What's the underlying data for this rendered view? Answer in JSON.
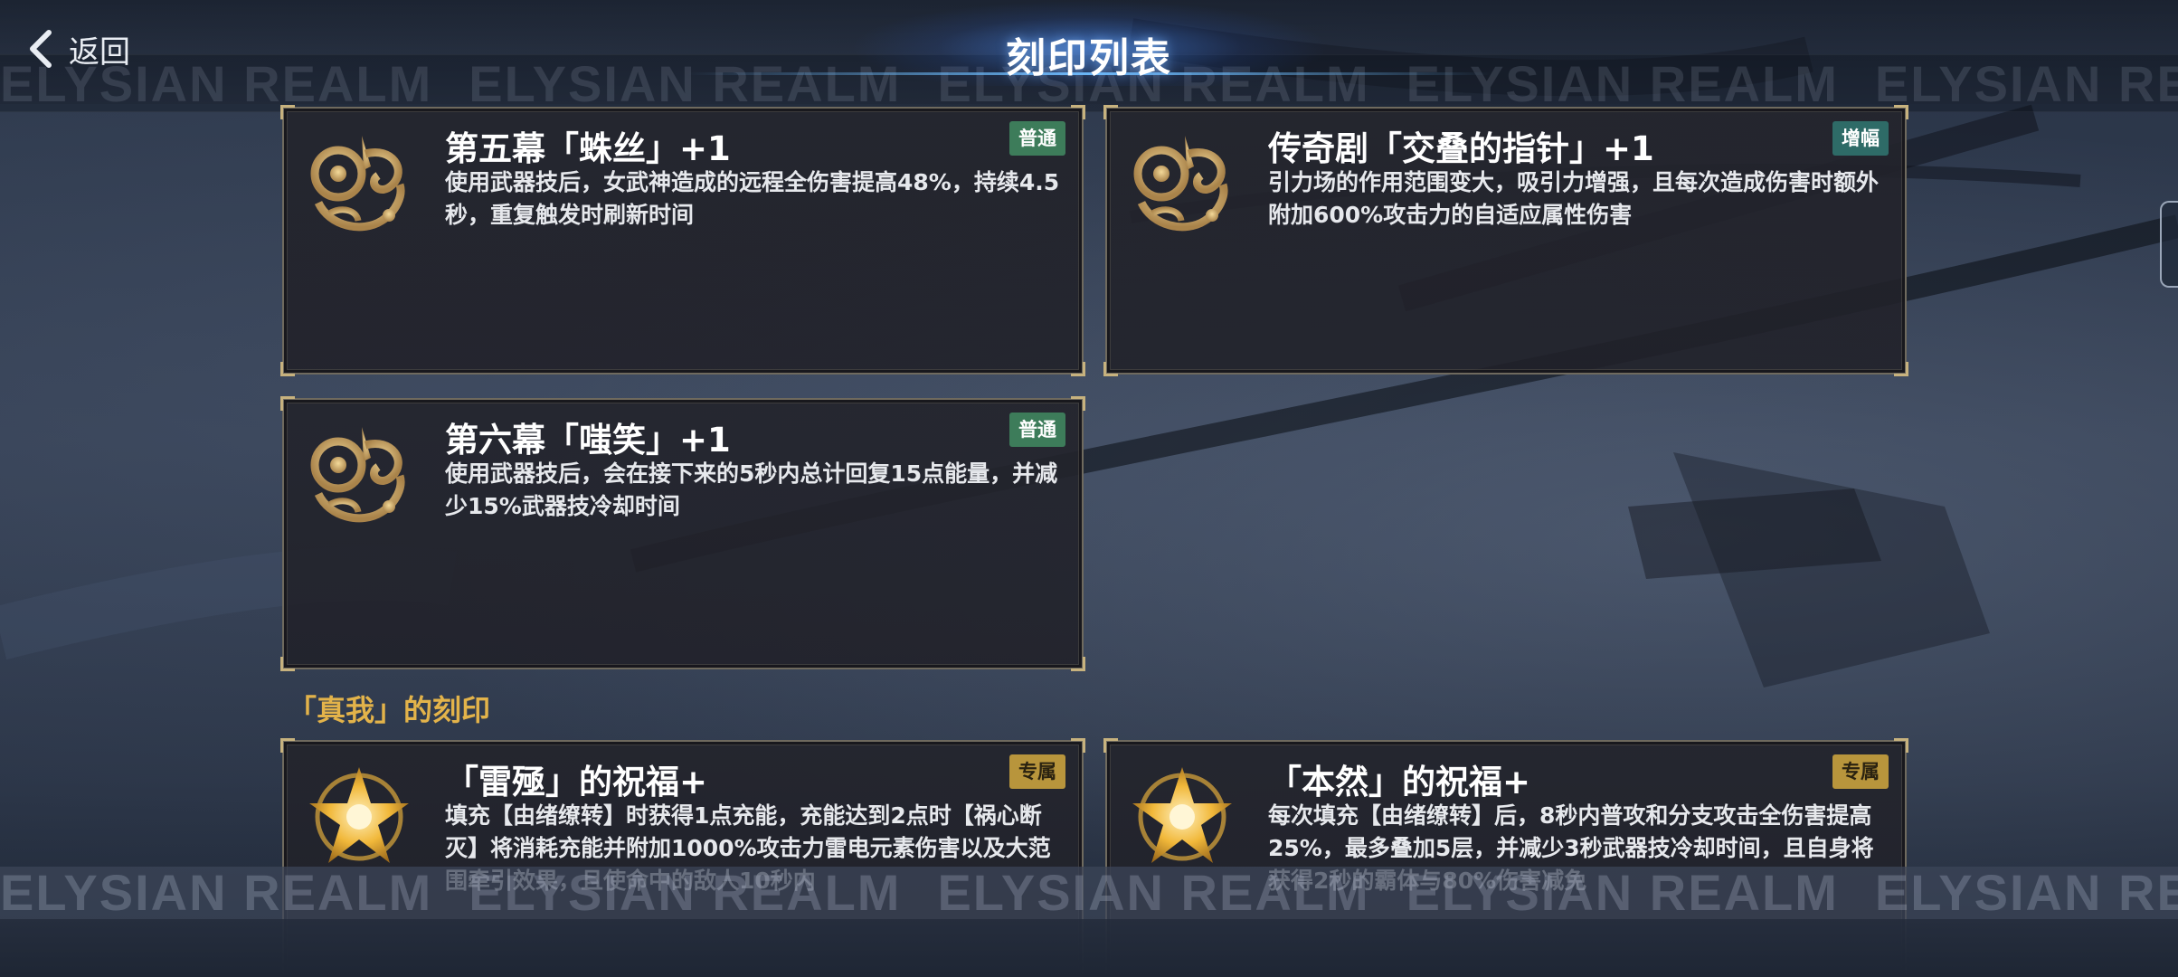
{
  "header": {
    "back_label": "返回",
    "title": "刻印列表"
  },
  "marquee_text": "ELYSIAN REALM",
  "cards": [
    {
      "title": "第五幕「蛛丝」+1",
      "badge": "普通",
      "badge_type": "normal",
      "icon": "gold-ornament-crest-icon",
      "description": "使用武器技后，女武神造成的远程全伤害提高48%，持续4.5秒，重复触发时刷新时间"
    },
    {
      "title": "传奇剧「交叠的指针」+1",
      "badge": "增幅",
      "badge_type": "boost",
      "icon": "gold-ornament-crest-icon",
      "description": "引力场的作用范围变大，吸引力增强，且每次造成伤害时额外附加600%攻击力的自适应属性伤害"
    },
    {
      "title": "第六幕「嗤笑」+1",
      "badge": "普通",
      "badge_type": "normal",
      "icon": "gold-ornament-crest-icon",
      "description": "使用武器技后，会在接下来的5秒内总计回复15点能量，并减少15%武器技冷却时间"
    }
  ],
  "section": {
    "label": "「真我」的刻印"
  },
  "exclusive_cards": [
    {
      "title": "「雷殛」的祝福+",
      "badge": "专属",
      "badge_type": "exclusive",
      "icon": "gold-star-flower-icon",
      "description": "填充【由绪缭转】时获得1点充能，充能达到2点时【祸心断灭】将消耗充能并附加1000%攻击力雷电元素伤害以及大范围牵引效果，且使命中的敌人10秒内"
    },
    {
      "title": "「本然」的祝福+",
      "badge": "专属",
      "badge_type": "exclusive",
      "icon": "gold-star-flower-icon",
      "description": "每次填充【由绪缭转】后，8秒内普攻和分支攻击全伤害提高25%，最多叠加5层，并减少3秒武器技冷却时间，且自身将获得2秒的霸体与80%伤害减免"
    }
  ],
  "colors": {
    "accent_gold": "#e3b34a",
    "badge_normal": "#3d7c5a",
    "badge_boost": "#2e6b67",
    "badge_exclusive": "#b8953c",
    "title_glow": "#6eb8ff"
  }
}
